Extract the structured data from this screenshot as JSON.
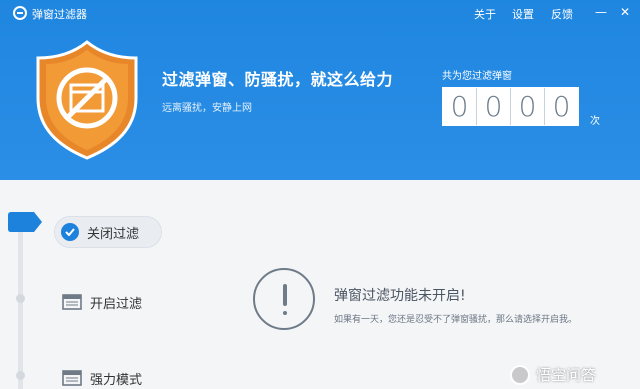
{
  "app": {
    "title": "弹窗过滤器",
    "menu": [
      "关于",
      "设置",
      "反馈"
    ],
    "min_label": "—",
    "close_label": "✕"
  },
  "banner": {
    "headline": "过滤弹窗、防骚扰，就这么给力",
    "subline": "远离骚扰，安静上网",
    "count_label": "共为您过滤弹窗",
    "digits": [
      "0",
      "0",
      "0",
      "0"
    ],
    "count_unit": "次"
  },
  "nav": {
    "items": [
      {
        "label": "关闭过滤",
        "icon": "check-circle-icon",
        "active": true
      },
      {
        "label": "开启过滤",
        "icon": "window-icon",
        "active": false
      },
      {
        "label": "强力模式",
        "icon": "window-icon",
        "active": false
      }
    ]
  },
  "status": {
    "title": "弹窗过滤功能未开启!",
    "description": "如果有一天，您还是忍受不了弹窗骚扰，那么请选择开启我。"
  },
  "watermark": {
    "text": "悟空问答"
  },
  "colors": {
    "header": "#1f86e0",
    "accent": "#1d82dc",
    "shield": "#f0962f"
  }
}
